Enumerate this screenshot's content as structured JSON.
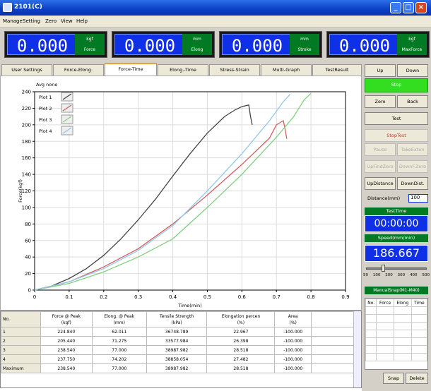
{
  "window": {
    "title": "2101(C)"
  },
  "menu": [
    {
      "label": "Manage",
      "u": "M"
    },
    {
      "label": "Setting",
      "u": "S"
    },
    {
      "label": "Zero",
      "u": "Z"
    },
    {
      "label": "View",
      "u": "V"
    },
    {
      "label": "Help",
      "u": "H"
    }
  ],
  "gauges": [
    {
      "value": "0.000",
      "unit": "kgf",
      "label": "Force"
    },
    {
      "value": "0.000",
      "unit": "mm",
      "label": "Elong"
    },
    {
      "value": "0.000",
      "unit": "mm",
      "label": "Stroke"
    },
    {
      "value": "0.000",
      "unit": "kgf",
      "label": "MaxForce"
    }
  ],
  "tabs": [
    "User Settings",
    "Force-Elong.",
    "Force-Time",
    "Elong.-Time",
    "Stress-Strain",
    "Multi-Graph",
    "TestResult"
  ],
  "active_tab": 2,
  "controls": {
    "up": "Up",
    "down": "Down",
    "stop": "Stop",
    "zero": "Zero",
    "back": "Back",
    "test": "Test",
    "stoptest": "StopTest",
    "pause": "Pause",
    "takeexten": "TakeExten",
    "upfindzero": "UpFindZero",
    "downfzero": "DownF.Zero",
    "updistance": "UpDistance",
    "downdist": "DownDist.",
    "distance_label": "Distance(mm)",
    "distance_value": "100",
    "testtime_label": "TestTime",
    "testtime_value": "00:00:00",
    "speed_label": "Speed(mm/min)",
    "speed_value": "186.667",
    "slider_ticks": [
      "50",
      "100",
      "200",
      "300",
      "400",
      "500"
    ],
    "slider_level": 0.28,
    "manualsnap_label": "ManualSnap(M1-M40)",
    "snap_headers": [
      "No.",
      "Force",
      "Elong",
      "Time"
    ],
    "snap": "Snap",
    "delete": "Delete"
  },
  "chart_data": {
    "type": "line",
    "title": "Avg none",
    "xlabel": "Time(min)",
    "ylabel": "Force(kgf)",
    "xlim": [
      0,
      0.9
    ],
    "ylim": [
      0,
      240
    ],
    "xticks": [
      "0",
      "0.1",
      "0.2",
      "0.3",
      "0.4",
      "0.5",
      "0.6",
      "0.7",
      "0.8",
      "0.9"
    ],
    "yticks": [
      "0",
      "20",
      "40",
      "60",
      "80",
      "100",
      "120",
      "140",
      "160",
      "180",
      "200",
      "220",
      "240"
    ],
    "grid": true,
    "legend_position": "top-left",
    "series": [
      {
        "name": "Plot 1",
        "color": "#444444",
        "x": [
          0,
          0.05,
          0.1,
          0.15,
          0.2,
          0.25,
          0.3,
          0.35,
          0.4,
          0.45,
          0.5,
          0.55,
          0.58,
          0.6,
          0.61,
          0.62,
          0.625,
          0.63
        ],
        "y": [
          0,
          5,
          14,
          26,
          42,
          62,
          85,
          110,
          138,
          165,
          190,
          210,
          218,
          222,
          223,
          224,
          210,
          200
        ]
      },
      {
        "name": "Plot 2",
        "color": "#d06060",
        "x": [
          0,
          0.1,
          0.2,
          0.3,
          0.4,
          0.5,
          0.6,
          0.65,
          0.68,
          0.7,
          0.72,
          0.725,
          0.73
        ],
        "y": [
          0,
          10,
          28,
          50,
          80,
          115,
          152,
          172,
          184,
          200,
          205,
          195,
          183
        ]
      },
      {
        "name": "Plot 3",
        "color": "#80d080",
        "x": [
          0,
          0.1,
          0.2,
          0.3,
          0.4,
          0.5,
          0.6,
          0.7,
          0.75,
          0.78,
          0.8
        ],
        "y": [
          0,
          8,
          22,
          40,
          62,
          100,
          140,
          185,
          210,
          230,
          238
        ]
      },
      {
        "name": "Plot 4",
        "color": "#90c8e8",
        "x": [
          0,
          0.1,
          0.2,
          0.3,
          0.4,
          0.5,
          0.6,
          0.68,
          0.72,
          0.74
        ],
        "y": [
          0,
          10,
          26,
          48,
          78,
          120,
          165,
          205,
          228,
          237
        ]
      }
    ]
  },
  "table": {
    "headers": [
      "No.",
      "Force @ Peak\n(kgf)",
      "Elong. @ Peak\n(mm)",
      "Tensile Strength\n(kPa)",
      "Elongation percen\n(%)",
      "Area\n(%)"
    ],
    "rows": [
      [
        "1",
        "224.840",
        "62.011",
        "36748.789",
        "22.967",
        "-100.000"
      ],
      [
        "2",
        "205.440",
        "71.275",
        "33577.984",
        "26.398",
        "-100.000"
      ],
      [
        "3",
        "238.540",
        "77.000",
        "38987.982",
        "28.518",
        "-100.000"
      ],
      [
        "4",
        "237.750",
        "74.202",
        "38858.054",
        "27.482",
        "-100.000"
      ],
      [
        "Maximum",
        "238.540",
        "77.000",
        "38987.982",
        "28.518",
        "-100.000"
      ]
    ]
  },
  "colors": {
    "title_bar": "#0a3fc4",
    "gauge_blue": "#1030e8",
    "gauge_green": "#007a23",
    "stop_green": "#33dd20"
  }
}
